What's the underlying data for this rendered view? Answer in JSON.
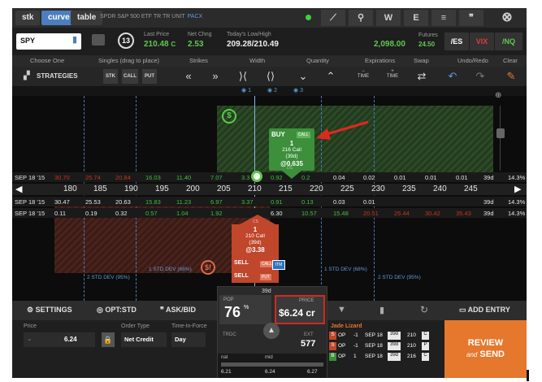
{
  "tabs": [
    "stk",
    "curve",
    "table"
  ],
  "active_tab": "curve",
  "instrument": {
    "name": "SPDR S&P 500 ETF TR TR UNIT",
    "exchange": "PACX"
  },
  "top_icons": [
    "chart-icon",
    "link-icon",
    "W",
    "E",
    "≡",
    "❞",
    "⊗"
  ],
  "quote": {
    "symbol": "SPY",
    "days": "13",
    "last_price_label": "Last Price",
    "last_price": "210.48",
    "last_price_suffix": "C",
    "net_chng_label": "Net Chng",
    "net_chng": "2.53",
    "range_label": "Today's Low/High",
    "range": "209.28/210.49",
    "futures_value": "2,098.00",
    "futures_label": "Futures",
    "futures_chg": "24.50",
    "futures_buttons": [
      "/ES",
      "VIX",
      "/NQ"
    ]
  },
  "headers": [
    "Choose One",
    "Singles (drag to place)",
    "Strikes",
    "Width",
    "Quantity",
    "Expirations",
    "Swap",
    "Undo/Redo",
    "Clear"
  ],
  "toolbar": {
    "strategies": "STRATEGIES",
    "type_buttons": [
      "STK",
      "CALL",
      "PUT"
    ],
    "time_minus": "TIME",
    "time_plus": "TIME"
  },
  "positions": [
    "1",
    "2",
    "3"
  ],
  "strikes": [
    "180",
    "185",
    "190",
    "195",
    "200",
    "205",
    "210",
    "215",
    "220",
    "225",
    "230",
    "235",
    "240",
    "245"
  ],
  "call_row": {
    "date": "SEP 18 '15",
    "values": [
      "30.70",
      "25.74",
      "20.84",
      "16.03",
      "11.40",
      "7.07",
      "3.3",
      "0.92",
      "0.2",
      "0.04",
      "0.02",
      "0.01",
      "0.01",
      "0.01"
    ],
    "dte": "39d",
    "iv": "14.3%"
  },
  "row2": {
    "date": "SEP 18 '15",
    "values": [
      "30.47",
      "25.53",
      "20.63",
      "15.83",
      "11.23",
      "6.97",
      "3.37",
      "0.91",
      "0.13",
      "0.03",
      "0.01",
      "",
      "",
      ""
    ],
    "dte": "39d",
    "iv": "14.3%"
  },
  "put_row": {
    "date": "SEP 18 '15",
    "values": [
      "0.11",
      "0.19",
      "0.32",
      "0.57",
      "1.04",
      "1.92",
      "",
      "6.30",
      "10.57",
      "15.48",
      "20.51",
      "25.44",
      "30.42",
      "35.43"
    ],
    "dte": "39d",
    "iv": "14.3%"
  },
  "buy_card": {
    "action": "BUY",
    "type": "CALL",
    "qty": "1",
    "desc": "216 Call",
    "dte": "(39d)",
    "price": "@0.635",
    "tag": "DS"
  },
  "sell_card": {
    "tag": "CS",
    "qty": "1",
    "desc": "210 Call",
    "dte": "(39d)",
    "price": "@3.38",
    "sell1": "SELL",
    "sell1_type": "CALL",
    "sell2": "SELL",
    "sell2_type": "PUT",
    "itm": "ITM"
  },
  "std_labels": {
    "left2": "2 STD DEV (95%)",
    "left1": "1 STD DEV (68%)",
    "right1": "1 STD DEV (68%)",
    "right2": "2 STD DEV (95%)"
  },
  "bottombar": {
    "settings": "SETTINGS",
    "optstd": "OPT:STD",
    "askbid": "ASK/BID",
    "add_entry": "ADD ENTRY"
  },
  "center": {
    "pop_label": "POP",
    "pop": "76",
    "pop_unit": "%",
    "dte": "39d",
    "price_label": "PRICE",
    "price": "$6.24 cr",
    "trdc_label": "TRDC",
    "ext_label": "EXT",
    "ext": "577",
    "nat_label": "nat",
    "mid_label": "mid",
    "nat": "6.21",
    "mid": "6.24",
    "far": "6.27"
  },
  "order": {
    "price_label": "Price",
    "price": "6.24",
    "order_type_label": "Order Type",
    "order_type": "Net Credit",
    "tif_label": "Time-In-Force",
    "tif": "Day"
  },
  "legs": {
    "title": "Jade Lizard",
    "rows": [
      {
        "side": "S",
        "oc": "OP",
        "qty": "-1",
        "exp": "SEP 18",
        "dte": "39d",
        "strike": "210",
        "type": "C"
      },
      {
        "side": "S",
        "oc": "OP",
        "qty": "-1",
        "exp": "SEP 18",
        "dte": "39d",
        "strike": "210",
        "type": "P"
      },
      {
        "side": "B",
        "oc": "OP",
        "qty": "1",
        "exp": "SEP 18",
        "dte": "39d",
        "strike": "216",
        "type": "C"
      }
    ]
  },
  "review": {
    "line1": "REVIEW",
    "line2a": "and",
    "line2b": "SEND"
  },
  "colors": {
    "accent": "#4c7dbf",
    "green": "#5ec94e",
    "red": "#c8321f",
    "orange": "#e5782c"
  }
}
